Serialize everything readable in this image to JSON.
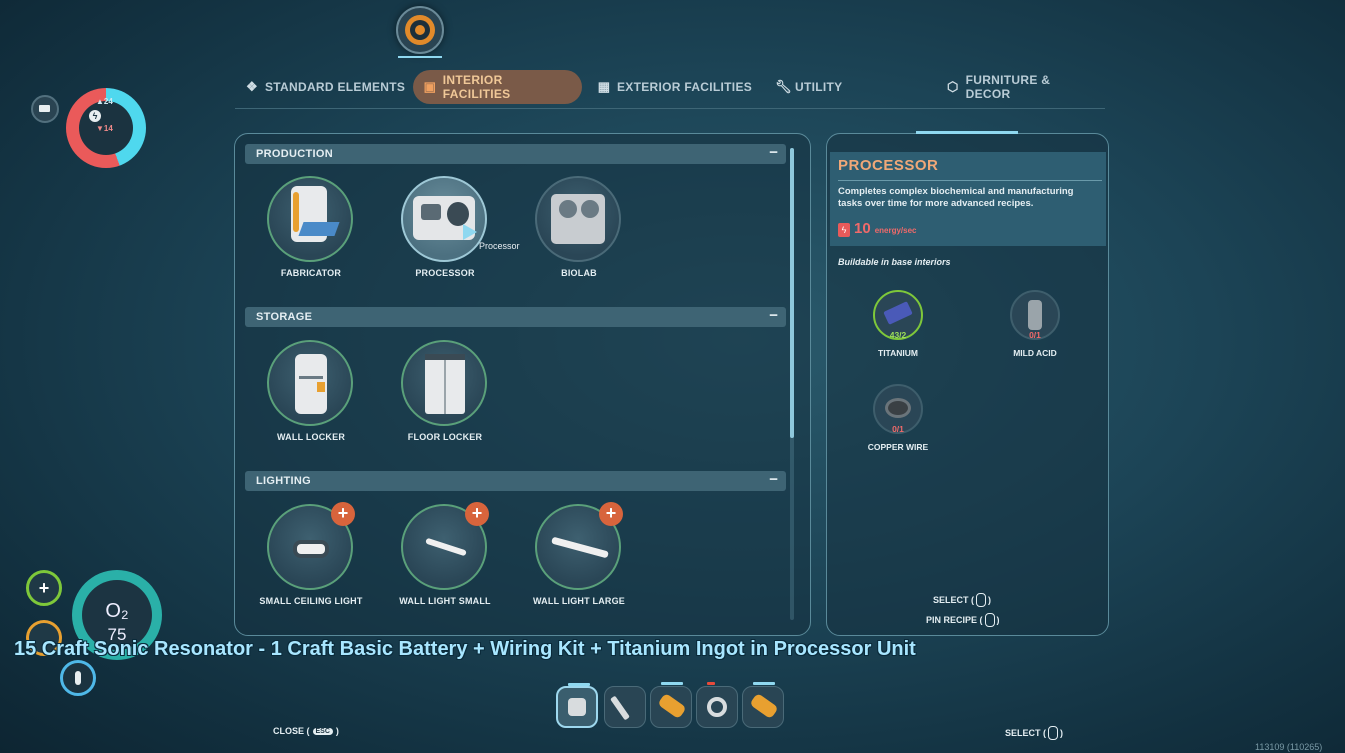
{
  "tabs": [
    {
      "label": "STANDARD ELEMENTS",
      "icon": "cube-cluster-icon",
      "active": false
    },
    {
      "label": "INTERIOR FACILITIES",
      "icon": "machine-icon",
      "active": true
    },
    {
      "label": "EXTERIOR FACILITIES",
      "icon": "structure-icon",
      "active": false
    },
    {
      "label": "UTILITY",
      "icon": "wrench-icon",
      "active": false
    },
    {
      "label": "FURNITURE & DECOR",
      "icon": "hexagon-cube-icon",
      "active": false
    }
  ],
  "status": {
    "energy_up": "24",
    "energy_down": "14",
    "oxygen_label": "O₂",
    "oxygen_value": "75",
    "health_symbol": "+"
  },
  "sections": [
    {
      "title": "PRODUCTION",
      "collapse": "−",
      "items": [
        {
          "label": "FABRICATOR",
          "icon": "fabricator-icon"
        },
        {
          "label": "PROCESSOR",
          "icon": "processor-icon",
          "selected": true
        },
        {
          "label": "BIOLAB",
          "icon": "biolab-icon"
        }
      ]
    },
    {
      "title": "STORAGE",
      "collapse": "−",
      "items": [
        {
          "label": "WALL LOCKER",
          "icon": "wall-locker-icon"
        },
        {
          "label": "FLOOR LOCKER",
          "icon": "floor-locker-icon"
        }
      ]
    },
    {
      "title": "LIGHTING",
      "collapse": "−",
      "items": [
        {
          "label": "SMALL CEILING LIGHT",
          "icon": "ceiling-light-icon",
          "new": "+"
        },
        {
          "label": "WALL LIGHT SMALL",
          "icon": "wall-light-small-icon",
          "new": "+"
        },
        {
          "label": "WALL LIGHT LARGE",
          "icon": "wall-light-large-icon",
          "new": "+"
        }
      ]
    }
  ],
  "tooltip": "Processor",
  "details": {
    "title": "PROCESSOR",
    "description": "Completes complex biochemical and manufacturing tasks over time for more advanced recipes.",
    "energy_value": "10",
    "energy_unit": "energy/sec",
    "buildable": "Buildable in base interiors",
    "ingredients": [
      {
        "name": "TITANIUM",
        "count": "43/2",
        "sufficient": true,
        "icon": "titanium-icon"
      },
      {
        "name": "MILD ACID",
        "count": "0/1",
        "sufficient": false,
        "icon": "mild-acid-icon"
      },
      {
        "name": "COPPER WIRE",
        "count": "0/1",
        "sufficient": false,
        "icon": "copper-wire-icon"
      }
    ],
    "select_hint": "SELECT (",
    "pin_hint": "PIN RECIPE (",
    "hint_close": ")"
  },
  "subtitle": "15 Craft Sonic Resonator - 1 Craft Basic Battery + Wiring Kit + Titanium Ingot in Processor Unit",
  "bottom": {
    "close_label": "CLOSE (",
    "close_key": "ESC",
    "select_label": "SELECT (",
    "paren_close": ")",
    "version": "113109 (110265)"
  },
  "hotbar": [
    "scanner-icon",
    "repair-tool-icon",
    "battery-icon",
    "grapple-icon",
    "battery-icon"
  ],
  "colors": {
    "accent": "#f0a878",
    "ok": "#7ec83a",
    "bad": "#f06a6a",
    "highlight": "#8fd8f0"
  }
}
